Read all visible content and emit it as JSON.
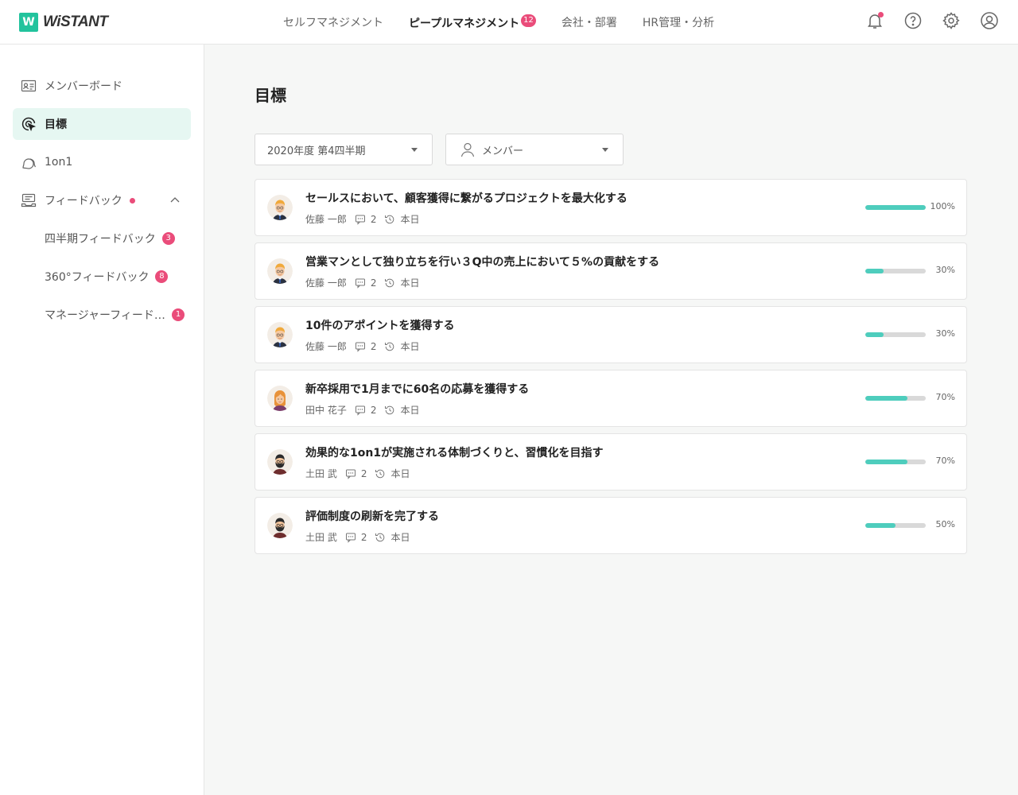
{
  "brand": {
    "logo_mark": "W",
    "name": "WiSTANT",
    "accent": "#22c39d"
  },
  "top_nav": [
    {
      "label": "セルフマネジメント",
      "active": false,
      "badge": ""
    },
    {
      "label": "ピープルマネジメント",
      "active": true,
      "badge": "12"
    },
    {
      "label": "会社・部署",
      "active": false,
      "badge": ""
    },
    {
      "label": "HR管理・分析",
      "active": false,
      "badge": ""
    }
  ],
  "header_icons": [
    "bell-icon",
    "help-icon",
    "gear-icon",
    "user-icon"
  ],
  "sidebar": {
    "items": [
      {
        "label": "メンバーボード",
        "icon": "member-board-icon",
        "active": false
      },
      {
        "label": "目標",
        "icon": "target-icon",
        "active": true
      },
      {
        "label": "1on1",
        "icon": "chat-icon",
        "active": false
      },
      {
        "label": "フィードバック",
        "icon": "feedback-icon",
        "active": false,
        "dot": true,
        "expanded": true
      }
    ],
    "sub_items": [
      {
        "label": "四半期フィードバック",
        "badge": "3"
      },
      {
        "label": "360°フィードバック",
        "badge": "8"
      },
      {
        "label": "マネージャーフィードバック",
        "badge": "1"
      }
    ]
  },
  "main": {
    "title": "目標",
    "period_select": "2020年度 第4四半期",
    "member_select": "メンバー"
  },
  "goals": [
    {
      "title": "セールスにおいて、顧客獲得に繋がるプロジェクトを最大化する",
      "owner": "佐藤 一郎",
      "comments": "2",
      "updated": "本日",
      "progress": 100,
      "progress_label": "100%",
      "avatar": "man-blond"
    },
    {
      "title": "営業マンとして独り立ちを行い３Q中の売上において５%の貢献をする",
      "owner": "佐藤 一郎",
      "comments": "2",
      "updated": "本日",
      "progress": 30,
      "progress_label": "30%",
      "avatar": "man-blond"
    },
    {
      "title": "10件のアポイントを獲得する",
      "owner": "佐藤 一郎",
      "comments": "2",
      "updated": "本日",
      "progress": 30,
      "progress_label": "30%",
      "avatar": "man-blond"
    },
    {
      "title": "新卒採用で1月までに60名の応募を獲得する",
      "owner": "田中 花子",
      "comments": "2",
      "updated": "本日",
      "progress": 70,
      "progress_label": "70%",
      "avatar": "woman"
    },
    {
      "title": "効果的な1on1が実施される体制づくりと、習慣化を目指す",
      "owner": "土田 武",
      "comments": "2",
      "updated": "本日",
      "progress": 70,
      "progress_label": "70%",
      "avatar": "man-beard"
    },
    {
      "title": "評価制度の刷新を完了する",
      "owner": "土田 武",
      "comments": "2",
      "updated": "本日",
      "progress": 50,
      "progress_label": "50%",
      "avatar": "man-beard"
    }
  ],
  "colors": {
    "badge": "#ea4c7a",
    "progress_fill": "#4ecdbd",
    "progress_track": "#d9d9d9",
    "active_bg": "#e6f7f2"
  }
}
